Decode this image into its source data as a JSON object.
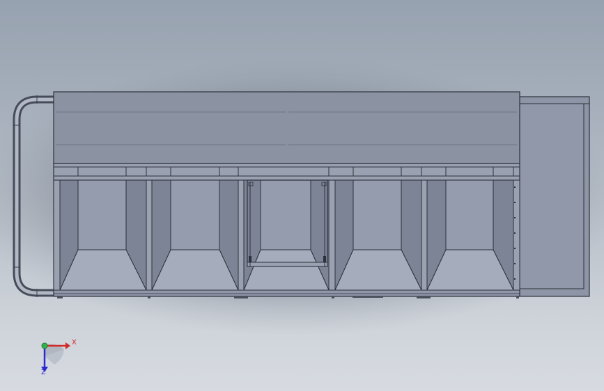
{
  "viewport": {
    "background_top": "#97a2b0",
    "background_bottom": "#d7dbe1"
  },
  "model": {
    "body_color": "#8f97a8",
    "top_panel_color": "#8b93a3",
    "edge_color": "#2d313c",
    "cabinet_count": 5
  },
  "triad": {
    "x_label": "X",
    "z_label": "Z",
    "x_color": "#d12a2a",
    "y_color": "#2fb34a",
    "z_color": "#2a2ad1"
  }
}
